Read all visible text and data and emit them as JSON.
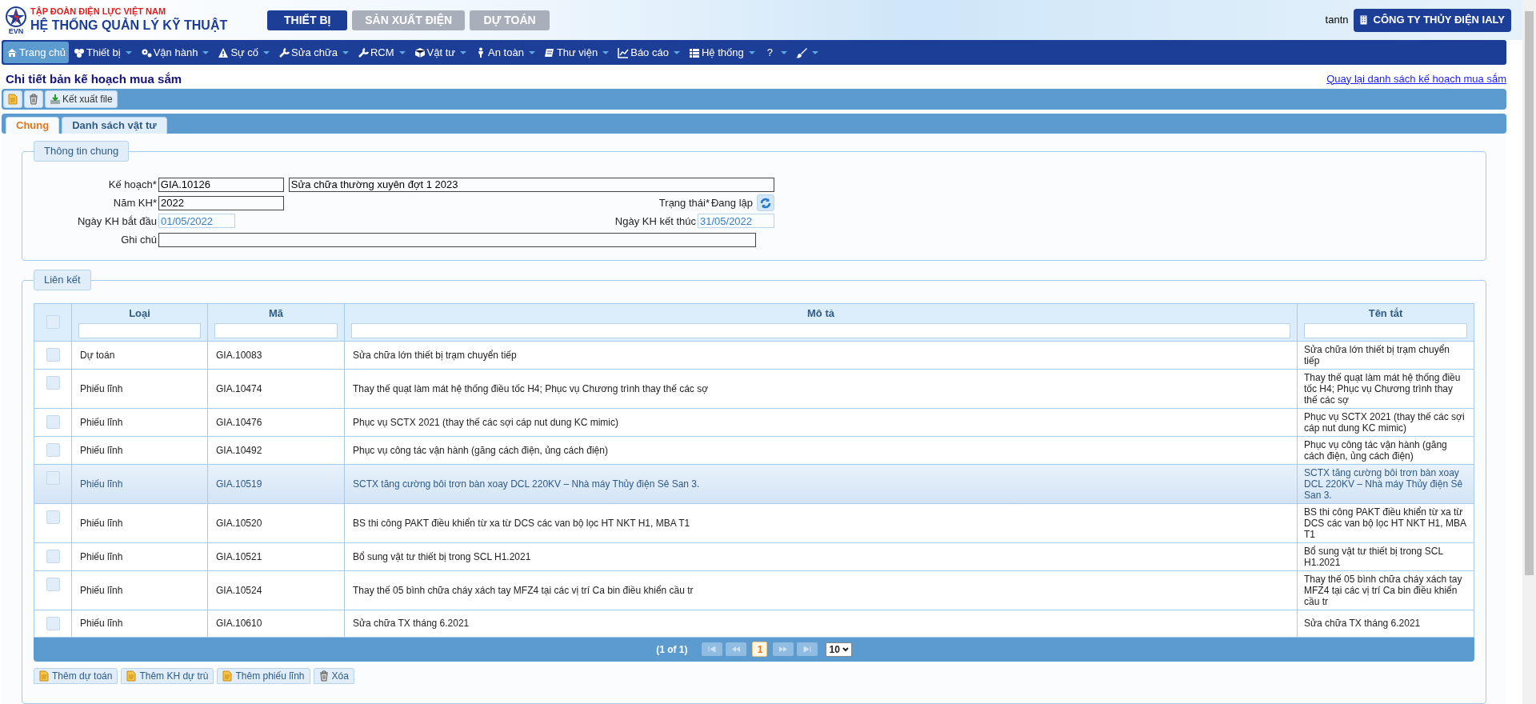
{
  "header": {
    "org": "TẬP ĐOÀN ĐIỆN LỰC VIỆT NAM",
    "logo_text": "EVN",
    "system": "HỆ THỐNG QUẢN LÝ KỸ THUẬT",
    "modules": [
      {
        "label": "THIẾT BỊ",
        "selected": true
      },
      {
        "label": "SẢN XUẤT ĐIỆN",
        "selected": false
      },
      {
        "label": "DỰ TOÁN",
        "selected": false
      }
    ],
    "user": "tantn",
    "company": "CÔNG TY THỦY ĐIỆN IALY"
  },
  "menu": [
    {
      "label": "Trang chủ",
      "selected": true,
      "dropdown": false
    },
    {
      "label": "Thiết bị",
      "selected": false,
      "dropdown": true
    },
    {
      "label": "Vận hành",
      "selected": false,
      "dropdown": true
    },
    {
      "label": "Sự cố",
      "selected": false,
      "dropdown": true
    },
    {
      "label": "Sửa chữa",
      "selected": false,
      "dropdown": true
    },
    {
      "label": "RCM",
      "selected": false,
      "dropdown": true
    },
    {
      "label": "Vật tư",
      "selected": false,
      "dropdown": true
    },
    {
      "label": "An toàn",
      "selected": false,
      "dropdown": true
    },
    {
      "label": "Thư viện",
      "selected": false,
      "dropdown": true
    },
    {
      "label": "Báo cáo",
      "selected": false,
      "dropdown": true
    },
    {
      "label": "Hệ thống",
      "selected": false,
      "dropdown": true
    },
    {
      "label": "?",
      "selected": false,
      "dropdown": true
    },
    {
      "selected": false,
      "dropdown": true
    }
  ],
  "page_title": "Chi tiết bản kế hoạch mua sắm",
  "back_link": "Quay lại danh sách kế hoạch mua sắm",
  "toolbar": [
    {
      "kind": "new"
    },
    {
      "kind": "delete"
    },
    {
      "kind": "export",
      "label": "Kết xuất file"
    }
  ],
  "tabs": [
    {
      "label": "Chung",
      "selected": true
    },
    {
      "label": "Danh sách vật tư",
      "selected": false
    }
  ],
  "general": {
    "legend": "Thông tin chung",
    "plan_label": "Kế hoạch*",
    "plan_code": "GIA.10126",
    "plan_name": "Sửa chữa thường xuyên đợt 1 2023",
    "year_label": "Năm KH*",
    "year": "2022",
    "status_label": "Trạng thái*",
    "status": "Đang lập",
    "start_label": "Ngày KH bắt đầu",
    "start": "01/05/2022",
    "end_label": "Ngày KH kết thúc",
    "end": "31/05/2022",
    "note_label": "Ghi chú"
  },
  "links": {
    "legend": "Liên kết",
    "all_checked": false,
    "columns": [
      "Loại",
      "Mã",
      "Mô tả",
      "Tên tắt"
    ],
    "rows": [
      {
        "type": "Dự toán",
        "code": "GIA.10083",
        "description": "Sửa chữa lớn thiết bị trạm chuyển tiếp",
        "short": "Sửa chữa lớn thiết bị trạm chuyển tiếp",
        "checked": false,
        "highlighted": false
      },
      {
        "type": "Phiếu lĩnh",
        "code": "GIA.10474",
        "description": "Thay thế quạt làm mát hệ thống điều tốc H4; Phục vụ Chương trình thay thế các sợ",
        "short": "Thay thế quạt làm mát hệ thống điều tốc H4; Phục vụ Chương trình thay thế các sợ",
        "checked": false,
        "highlighted": false
      },
      {
        "type": "Phiếu lĩnh",
        "code": "GIA.10476",
        "description": "Phục vụ SCTX 2021 (thay thế các sợi cáp nut dung KC mimic)",
        "short": "Phục vụ SCTX 2021 (thay thế các sợi cáp nut dung KC mimic)",
        "checked": false,
        "highlighted": false
      },
      {
        "type": "Phiếu lĩnh",
        "code": "GIA.10492",
        "description": "Phục vụ công tác vận hành (găng cách điện, ủng cách điện)",
        "short": "Phục vụ công tác vận hành (găng cách điện, ủng cách điện)",
        "checked": false,
        "highlighted": false
      },
      {
        "type": "Phiếu lĩnh",
        "code": "GIA.10519",
        "description": "SCTX tăng cường bôi trơn bàn xoay DCL 220KV – Nhà máy Thủy điện Sê San 3.",
        "short": "SCTX tăng cường bôi trơn bàn xoay DCL 220KV – Nhà máy Thủy điện Sê San 3.",
        "checked": false,
        "highlighted": true
      },
      {
        "type": "Phiếu lĩnh",
        "code": "GIA.10520",
        "description": "BS thi công PAKT điều khiển từ xa từ DCS các van bộ lọc HT NKT H1, MBA T1",
        "short": "BS thi công PAKT điều khiển từ xa từ DCS các van bộ lọc HT NKT H1, MBA T1",
        "checked": false,
        "highlighted": false
      },
      {
        "type": "Phiếu lĩnh",
        "code": "GIA.10521",
        "description": "Bổ sung vật tư thiết bị trong SCL H1.2021",
        "short": "Bổ sung vật tư thiết bị trong SCL H1.2021",
        "checked": false,
        "highlighted": false
      },
      {
        "type": "Phiếu lĩnh",
        "code": "GIA.10524",
        "description": "Thay thế 05 bình chữa cháy xách tay MFZ4 tại các vị trí Ca bin điều khiển cầu tr",
        "short": "Thay thế 05 bình chữa cháy xách tay MFZ4 tại các vị trí Ca bin điều khiển cầu tr",
        "checked": false,
        "highlighted": false
      },
      {
        "type": "Phiếu lĩnh",
        "code": "GIA.10610",
        "description": "Sửa chữa TX tháng 6.2021",
        "short": "Sửa chữa TX tháng 6.2021",
        "checked": false,
        "highlighted": false
      }
    ],
    "pager": {
      "summary": "(1 of 1)",
      "pages": [
        {
          "label": "1",
          "selected": true
        }
      ],
      "page_size": "10"
    },
    "actions": [
      {
        "kind": "add",
        "label": "Thêm dự toán"
      },
      {
        "kind": "add",
        "label": "Thêm KH dự trù"
      },
      {
        "kind": "add",
        "label": "Thêm phiếu lĩnh"
      },
      {
        "kind": "delete",
        "label": "Xóa"
      }
    ]
  }
}
